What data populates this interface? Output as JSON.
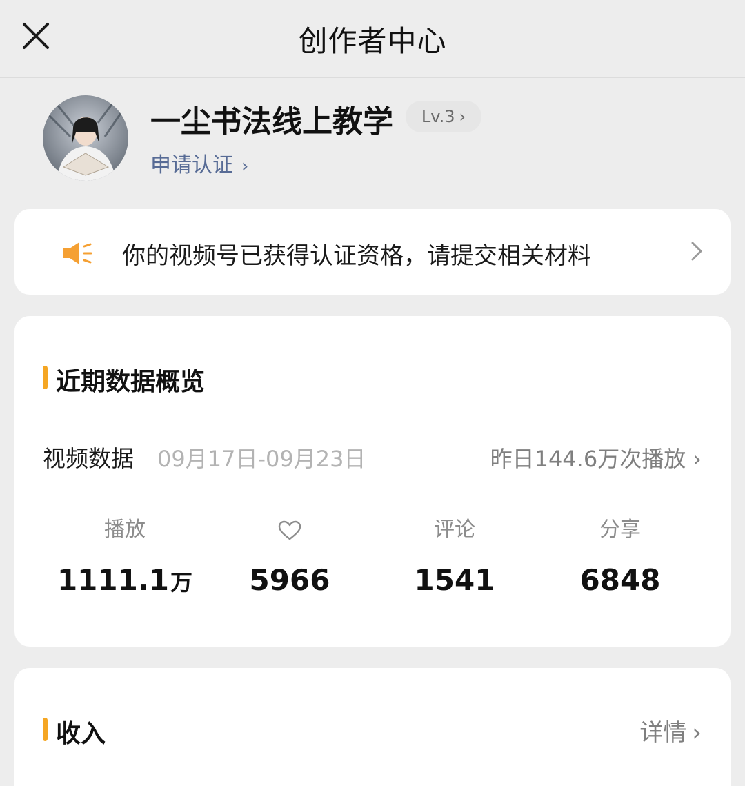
{
  "header": {
    "title": "创作者中心",
    "close_icon": "close-icon"
  },
  "profile": {
    "name": "一尘书法线上教学",
    "level": "Lv.3",
    "apply_label": "申请认证"
  },
  "notice": {
    "icon": "speaker-icon",
    "icon_color": "#f5a033",
    "text": "你的视频号已获得认证资格，请提交相关材料"
  },
  "overview": {
    "title": "近期数据概览",
    "accent_color": "#f5a623",
    "video_label": "视频数据",
    "date_range": "09月17日-09月23日",
    "yesterday_label": "昨日144.6万次播放",
    "metrics": [
      {
        "label": "播放",
        "value": "1111.1",
        "unit": "万"
      },
      {
        "label": "",
        "icon": "heart-icon",
        "value": "5966",
        "unit": ""
      },
      {
        "label": "评论",
        "value": "1541",
        "unit": ""
      },
      {
        "label": "分享",
        "value": "6848",
        "unit": ""
      }
    ]
  },
  "income": {
    "title": "收入",
    "detail_label": "详情"
  },
  "link_color": "#576b95"
}
